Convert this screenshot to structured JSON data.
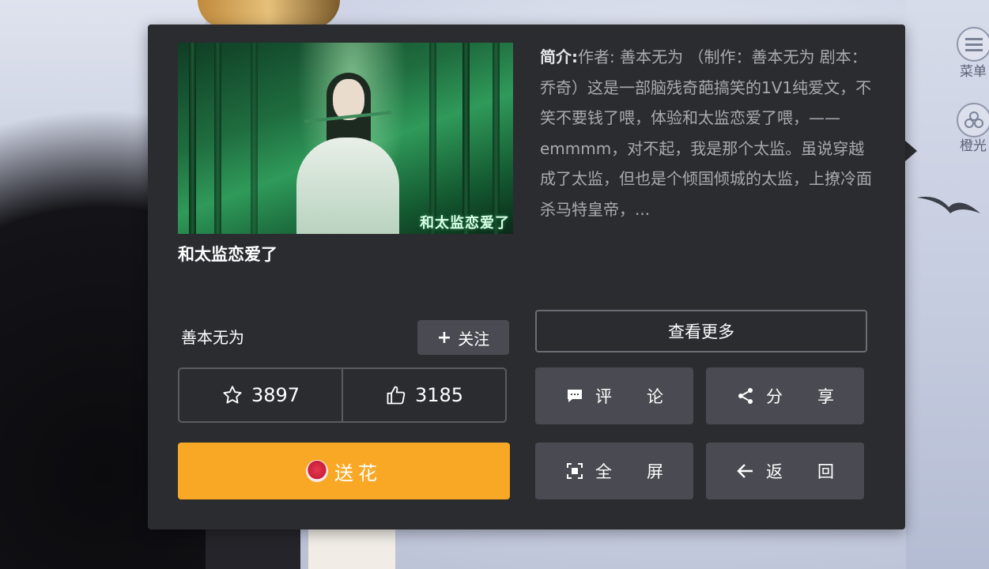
{
  "book": {
    "title": "和太监恋爱了",
    "cover_text": "和太监恋爱了",
    "synopsis_label": "简介:",
    "synopsis": "作者: 善本无为 （制作：善本无为 剧本：乔奇）这是一部脑残奇葩搞笑的1V1纯爱文，不笑不要钱了喂，体验和太监恋爱了喂，——emmmm，对不起，我是那个太监。虽说穿越成了太监，但也是个倾国倾城的太监，上撩冷面杀马特皇帝，..."
  },
  "author": {
    "name": "善本无为",
    "follow_label": "关注"
  },
  "stats": {
    "favorites": "3897",
    "likes": "3185"
  },
  "buttons": {
    "gift_flower": "送花",
    "see_more": "查看更多",
    "comment": "评论",
    "share": "分享",
    "fullscreen": "全屏",
    "back": "返回"
  },
  "side_menu": {
    "menu_label": "菜单",
    "light_label": "橙光"
  },
  "colors": {
    "card_bg": "#2b2c30",
    "button_bg": "#4a4b52",
    "accent_orange": "#f9a825"
  },
  "icons": [
    "star-icon",
    "thumbs-up-icon",
    "comment-icon",
    "share-icon",
    "fullscreen-icon",
    "arrow-left-icon",
    "flower-icon",
    "plus-icon"
  ]
}
